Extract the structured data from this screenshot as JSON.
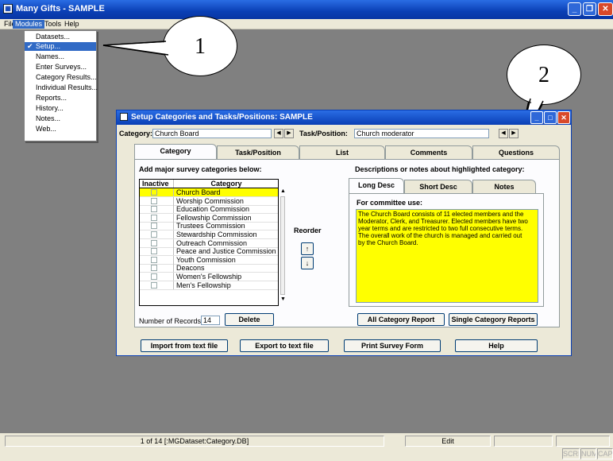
{
  "app": {
    "title": "Many Gifts - SAMPLE",
    "icon": "app-icon"
  },
  "menubar": [
    "File",
    "Modules",
    "Tools",
    "Help"
  ],
  "modules_menu": [
    "Datasets...",
    "Setup...",
    "Names...",
    "Enter Surveys...",
    "Category Results...",
    "Individual Results...",
    "Reports...",
    "History...",
    "Notes...",
    "Web..."
  ],
  "callouts": [
    "1",
    "2"
  ],
  "window": {
    "title": "Setup Categories and Tasks/Positions: SAMPLE",
    "category_label": "Category:",
    "category_value": "Church Board",
    "task_label": "Task/Position:",
    "task_value": "Church moderator",
    "tabs": [
      "Category",
      "Task/Position",
      "List",
      "Comments",
      "Questions"
    ],
    "add_label": "Add major survey categories below:",
    "grid": {
      "headers": [
        "Inactive",
        "Category"
      ],
      "rows": [
        "Church Board",
        "Worship Commission",
        "Education Commission",
        "Fellowship Commission",
        "Trustees Commission",
        "Stewardship Commission",
        "Outreach Commission",
        "Peace and Justice Commission",
        "Youth Commission",
        "Deacons",
        "Women's Fellowship",
        "Men's Fellowship"
      ]
    },
    "reorder_label": "Reorder",
    "up_arrow": "↑",
    "down_arrow": "↓",
    "records_label": "Number of Records:",
    "records_value": "14",
    "delete_label": "Delete",
    "desc_label": "Descriptions or notes about highlighted category:",
    "sub_tabs": [
      "Long Desc",
      "Short Desc",
      "Notes"
    ],
    "committee_label": "For committee use:",
    "notes_text": "The Church Board consists of 11 elected members and the Moderator, Clerk, and Treasurer. Elected members have two year terms and are restricted to two full consecutive terms. The overall work of the church is managed and carried out by the Church Board.",
    "all_report": "All Category Report",
    "single_report": "Single Category Reports",
    "bottom_buttons": [
      "Import from text file",
      "Export to text file",
      "Print Survey Form",
      "Help"
    ]
  },
  "status": {
    "record": "1 of 14 [:MGDataset:Category.DB]",
    "mode": "Edit",
    "keys": [
      "SCRL",
      "NUM",
      "CAPS"
    ]
  },
  "colors": {
    "titlebar": "#0a3fb5",
    "highlight": "#ffff00",
    "workspace": "#808080",
    "selection": "#316ac5"
  }
}
